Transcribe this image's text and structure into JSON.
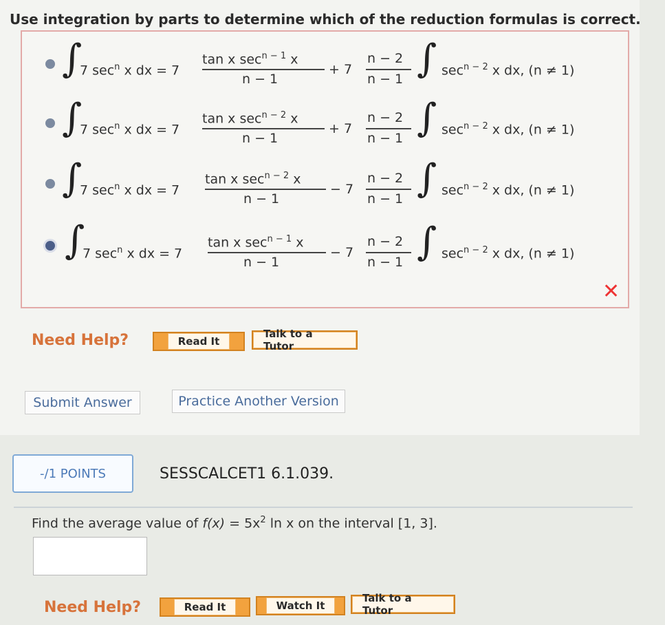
{
  "question": {
    "prompt": "Use integration by parts to determine which of the reduction formulas is correct."
  },
  "choices": [
    {
      "lhs": "7 sec",
      "lhs_n": "n",
      "lhs_tail": "x dx = 7",
      "frac1_num": "tan x sec",
      "frac1_exp": "n − 1",
      "frac1_num_tail": "x",
      "frac1_den": "n − 1",
      "op": "+ 7",
      "frac2_num": "n − 2",
      "frac2_den": "n − 1",
      "rhs": "sec",
      "rhs_exp": "n − 2",
      "rhs_tail": "x dx, (n ≠ 1)",
      "selected": false
    },
    {
      "lhs": "7 sec",
      "lhs_n": "n",
      "lhs_tail": "x dx = 7",
      "frac1_num": "tan x sec",
      "frac1_exp": "n − 2",
      "frac1_num_tail": "x",
      "frac1_den": "n − 1",
      "op": "+ 7",
      "frac2_num": "n − 2",
      "frac2_den": "n − 1",
      "rhs": "sec",
      "rhs_exp": "n − 2",
      "rhs_tail": "x dx, (n ≠ 1)",
      "selected": false
    },
    {
      "lhs": "7 sec",
      "lhs_n": "n",
      "lhs_tail": "x dx = 7",
      "frac1_num": "tan x sec",
      "frac1_exp": "n − 2",
      "frac1_num_tail": "x",
      "frac1_den": "n − 1",
      "op": "− 7",
      "frac2_num": "n − 2",
      "frac2_den": "n − 1",
      "rhs": "sec",
      "rhs_exp": "n − 2",
      "rhs_tail": "x dx, (n ≠ 1)",
      "selected": false
    },
    {
      "lhs": "7 sec",
      "lhs_n": "n",
      "lhs_tail": "x dx = 7",
      "frac1_num": "tan x sec",
      "frac1_exp": "n − 1",
      "frac1_num_tail": "x",
      "frac1_den": "n − 1",
      "op": "− 7",
      "frac2_num": "n − 2",
      "frac2_den": "n − 1",
      "rhs": "sec",
      "rhs_exp": "n − 2",
      "rhs_tail": "x dx, (n ≠ 1)",
      "selected": true
    }
  ],
  "result_icon": "wrong-x-icon",
  "help1": {
    "label": "Need Help?",
    "read_it": "Read It",
    "talk_tutor": "Talk to a Tutor"
  },
  "actions": {
    "submit": "Submit Answer",
    "practice": "Practice Another Version"
  },
  "next_problem": {
    "points": "-/1 POINTS",
    "id": "SESSCALCET1 6.1.039.",
    "text_prefix": "Find the average value of ",
    "function_name": "f(x)",
    "equals": " = 5x",
    "power": "2",
    "text_suffix": " ln x  on the interval [1, 3].",
    "answer_value": ""
  },
  "help2": {
    "label": "Need Help?",
    "read_it": "Read It",
    "watch_it": "Watch It",
    "talk_tutor": "Talk to a Tutor"
  },
  "colors": {
    "need_help": "#d7733b",
    "button_orange": "#f2a23e",
    "wrong_red": "#e33333",
    "link_blue": "#4a6c9c"
  }
}
